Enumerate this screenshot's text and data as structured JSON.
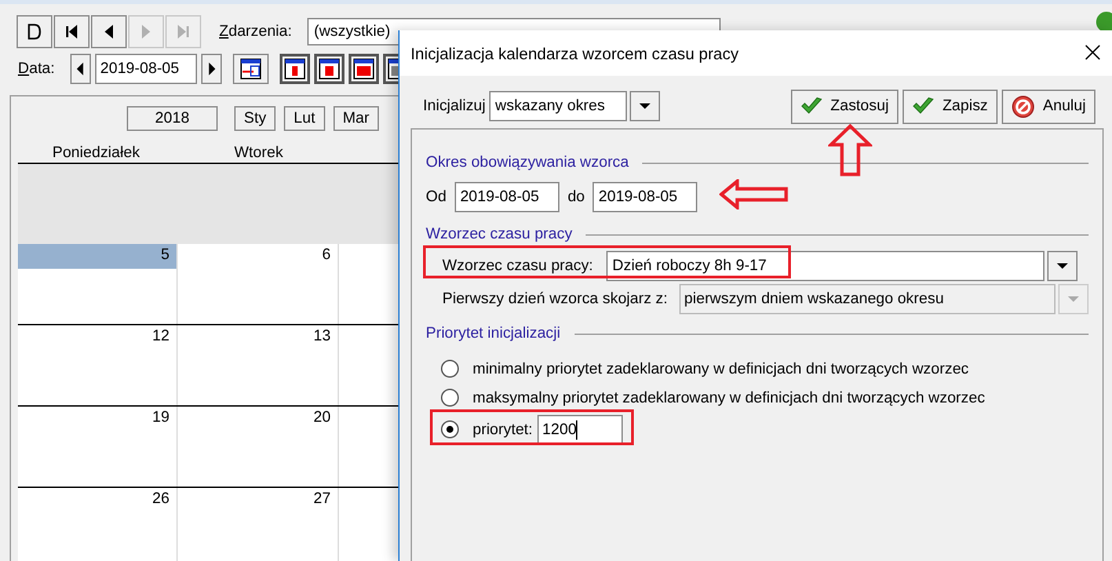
{
  "toolbar": {
    "nav_buttons": [
      {
        "kind": "new",
        "disabled": false
      },
      {
        "kind": "first",
        "disabled": false
      },
      {
        "kind": "prev",
        "disabled": false
      },
      {
        "kind": "next",
        "disabled": true
      },
      {
        "kind": "last",
        "disabled": true
      }
    ],
    "events_label": "Zdarzenia:",
    "events_value": "(wszystkie)"
  },
  "date_bar": {
    "label": "Data:",
    "value": "2019-08-05"
  },
  "calendar": {
    "year": "2018",
    "months": [
      "Sty",
      "Lut",
      "Mar"
    ],
    "weekdays": [
      "Poniedziałek",
      "Wtorek"
    ],
    "weeks": [
      {
        "days": [
          {
            "label": "5",
            "selected": true
          },
          {
            "label": "6",
            "selected": false
          }
        ]
      },
      {
        "days": [
          {
            "label": "12",
            "selected": false
          },
          {
            "label": "13",
            "selected": false
          }
        ]
      },
      {
        "days": [
          {
            "label": "19",
            "selected": false
          },
          {
            "label": "20",
            "selected": false
          }
        ]
      },
      {
        "days": [
          {
            "label": "26",
            "selected": false
          },
          {
            "label": "27",
            "selected": false
          }
        ]
      }
    ]
  },
  "dialog": {
    "title": "Inicjalizacja kalendarza wzorcem czasu pracy",
    "init_label": "Inicjalizuj",
    "init_value": "wskazany okres",
    "buttons": [
      {
        "kind": "apply",
        "label": "Zastosuj"
      },
      {
        "kind": "save",
        "label": "Zapisz"
      },
      {
        "kind": "cancel",
        "label": "Anuluj"
      }
    ],
    "period": {
      "title": "Okres obowiązywania wzorca",
      "from_label": "Od",
      "from": "2019-08-05",
      "to_label": "do",
      "to": "2019-08-05"
    },
    "pattern": {
      "title": "Wzorzec czasu pracy",
      "pattern_label": "Wzorzec czasu pracy:",
      "pattern_value": "Dzień roboczy 8h 9-17",
      "link_label": "Pierwszy dzień wzorca skojarz z:",
      "link_value": "pierwszym dniem wskazanego okresu",
      "link_disabled": true
    },
    "priority": {
      "title": "Priorytet inicjalizacji",
      "options": [
        {
          "label": "minimalny priorytet zadeklarowany w definicjach dni tworzących wzorzec",
          "selected": false
        },
        {
          "label": "maksymalny priorytet zadeklarowany w definicjach dni tworzących wzorzec",
          "selected": false
        },
        {
          "label": "priorytet:",
          "selected": true,
          "value": "1200"
        }
      ]
    }
  }
}
